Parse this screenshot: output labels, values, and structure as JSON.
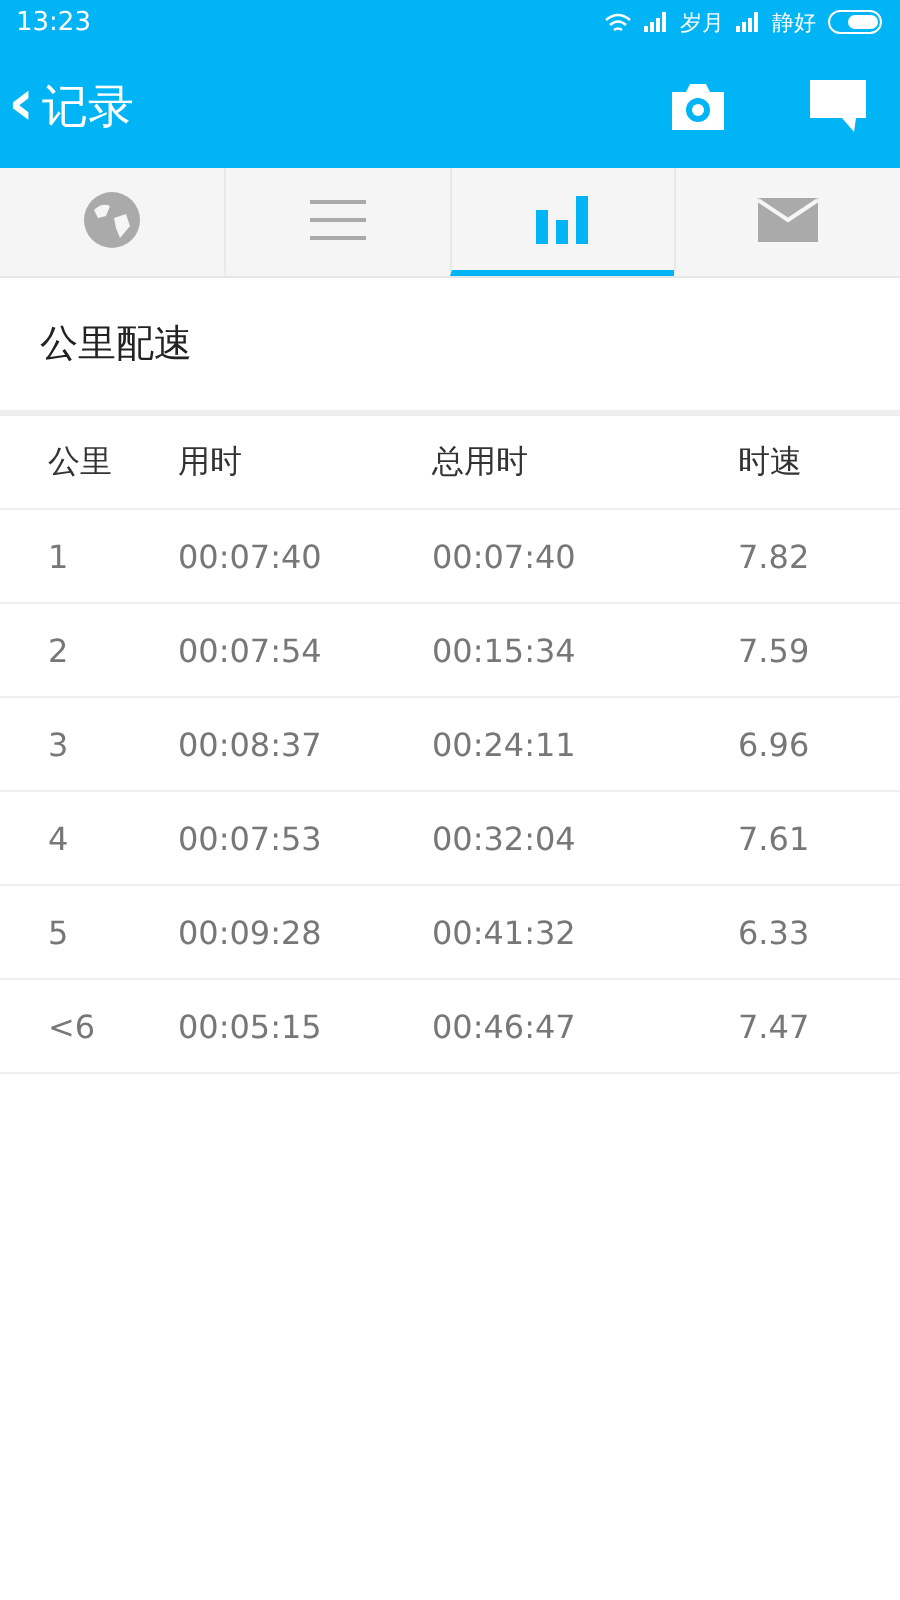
{
  "status_bar": {
    "time": "13:23",
    "carriers": [
      "岁月",
      "静好"
    ]
  },
  "app_bar": {
    "back": "‹",
    "title": "记录"
  },
  "tabs": [
    {
      "kind": "globe",
      "selected": false
    },
    {
      "kind": "list",
      "selected": false
    },
    {
      "kind": "chart",
      "selected": true
    },
    {
      "kind": "mail",
      "selected": false
    }
  ],
  "section_title": "公里配速",
  "table": {
    "columns": [
      "公里",
      "用时",
      "总用时",
      "时速"
    ],
    "rows": [
      [
        "1",
        "00:07:40",
        "00:07:40",
        "7.82"
      ],
      [
        "2",
        "00:07:54",
        "00:15:34",
        "7.59"
      ],
      [
        "3",
        "00:08:37",
        "00:24:11",
        "6.96"
      ],
      [
        "4",
        "00:07:53",
        "00:32:04",
        "7.61"
      ],
      [
        "5",
        "00:09:28",
        "00:41:32",
        "6.33"
      ],
      [
        "<6",
        "00:05:15",
        "00:46:47",
        "7.47"
      ]
    ]
  }
}
